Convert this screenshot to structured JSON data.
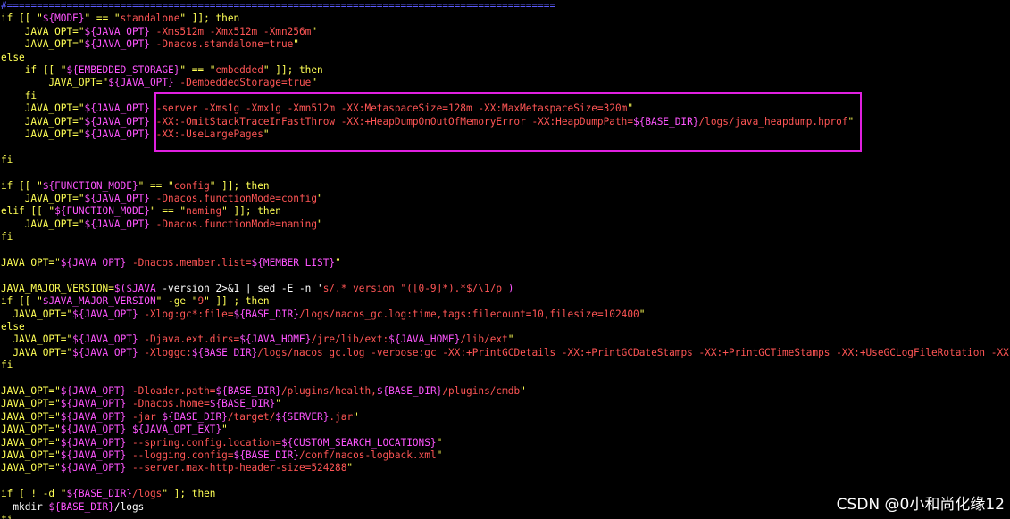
{
  "colors": {
    "plain": "#ffffff",
    "keyword": "#ffff55",
    "variable": "#ff55ff",
    "string": "#ff5555",
    "comment": "#5c5cff",
    "highlight_box": "#e020e0",
    "background": "#000000"
  },
  "watermark": "CSDN @0小和尚化缘12",
  "lines": [
    [
      [
        "#============================================================================================",
        "comment"
      ]
    ],
    [
      [
        "if [[ \"",
        "kw"
      ],
      [
        "${MODE}",
        "var"
      ],
      [
        "\" == \"",
        "kw"
      ],
      [
        "standalone",
        "str"
      ],
      [
        "\" ]]; then",
        "kw"
      ]
    ],
    [
      [
        "    JAVA_OPT=\"",
        "kw"
      ],
      [
        "${JAVA_OPT}",
        "var"
      ],
      [
        " -Xms512m -Xmx512m -Xmn256m",
        "str"
      ],
      [
        "\"",
        "kw"
      ]
    ],
    [
      [
        "    JAVA_OPT=\"",
        "kw"
      ],
      [
        "${JAVA_OPT}",
        "var"
      ],
      [
        " -Dnacos.standalone=true",
        "str"
      ],
      [
        "\"",
        "kw"
      ]
    ],
    [
      [
        "else",
        "kw"
      ]
    ],
    [
      [
        "    if [[ \"",
        "kw"
      ],
      [
        "${EMBEDDED_STORAGE}",
        "var"
      ],
      [
        "\" == \"",
        "kw"
      ],
      [
        "embedded",
        "str"
      ],
      [
        "\" ]]; then",
        "kw"
      ]
    ],
    [
      [
        "        JAVA_OPT=\"",
        "kw"
      ],
      [
        "${JAVA_OPT}",
        "var"
      ],
      [
        " -DembeddedStorage=true",
        "str"
      ],
      [
        "\"",
        "kw"
      ]
    ],
    [
      [
        "    fi",
        "kw"
      ]
    ],
    [
      [
        "    JAVA_OPT=\"",
        "kw"
      ],
      [
        "${JAVA_OPT}",
        "var"
      ],
      [
        " -server -Xms1g -Xmx1g -Xmn512m -XX:MetaspaceSize=128m -XX:MaxMetaspaceSize=320m",
        "str"
      ],
      [
        "\"",
        "kw"
      ]
    ],
    [
      [
        "    JAVA_OPT=\"",
        "kw"
      ],
      [
        "${JAVA_OPT}",
        "var"
      ],
      [
        " -XX:-OmitStackTraceInFastThrow -XX:+HeapDumpOnOutOfMemoryError -XX:HeapDumpPath=",
        "str"
      ],
      [
        "${BASE_DIR}",
        "var"
      ],
      [
        "/logs/java_heapdump.hprof",
        "str"
      ],
      [
        "\"",
        "kw"
      ]
    ],
    [
      [
        "    JAVA_OPT=\"",
        "kw"
      ],
      [
        "${JAVA_OPT}",
        "var"
      ],
      [
        " -XX:-UseLargePages",
        "str"
      ],
      [
        "\"",
        "kw"
      ]
    ],
    [],
    [
      [
        "fi",
        "kw"
      ]
    ],
    [],
    [
      [
        "if [[ \"",
        "kw"
      ],
      [
        "${FUNCTION_MODE}",
        "var"
      ],
      [
        "\" == \"",
        "kw"
      ],
      [
        "config",
        "str"
      ],
      [
        "\" ]]; then",
        "kw"
      ]
    ],
    [
      [
        "    JAVA_OPT=\"",
        "kw"
      ],
      [
        "${JAVA_OPT}",
        "var"
      ],
      [
        " -Dnacos.functionMode=config",
        "str"
      ],
      [
        "\"",
        "kw"
      ]
    ],
    [
      [
        "elif [[ \"",
        "kw"
      ],
      [
        "${FUNCTION_MODE}",
        "var"
      ],
      [
        "\" == \"",
        "kw"
      ],
      [
        "naming",
        "str"
      ],
      [
        "\" ]]; then",
        "kw"
      ]
    ],
    [
      [
        "    JAVA_OPT=\"",
        "kw"
      ],
      [
        "${JAVA_OPT}",
        "var"
      ],
      [
        " -Dnacos.functionMode=naming",
        "str"
      ],
      [
        "\"",
        "kw"
      ]
    ],
    [
      [
        "fi",
        "kw"
      ]
    ],
    [],
    [
      [
        "JAVA_OPT=\"",
        "kw"
      ],
      [
        "${JAVA_OPT}",
        "var"
      ],
      [
        " -Dnacos.member.list=",
        "str"
      ],
      [
        "${MEMBER_LIST}",
        "var"
      ],
      [
        "\"",
        "kw"
      ]
    ],
    [],
    [
      [
        "JAVA_MAJOR_VERSION=",
        "kw"
      ],
      [
        "$(",
        "var"
      ],
      [
        "$JAVA",
        "var"
      ],
      [
        " -version 2>&1 | sed -E -n '",
        "plain"
      ],
      [
        "s/.* version \"([0-9]*).*$/\\1/p",
        "str"
      ],
      [
        "')",
        "var"
      ]
    ],
    [
      [
        "if [[ \"",
        "kw"
      ],
      [
        "$JAVA_MAJOR_VERSION",
        "var"
      ],
      [
        "\" -ge \"",
        "kw"
      ],
      [
        "9",
        "str"
      ],
      [
        "\" ]] ; then",
        "kw"
      ]
    ],
    [
      [
        "  JAVA_OPT=\"",
        "kw"
      ],
      [
        "${JAVA_OPT}",
        "var"
      ],
      [
        " -Xlog:gc*:file=",
        "str"
      ],
      [
        "${BASE_DIR}",
        "var"
      ],
      [
        "/logs/nacos_gc.log:time,tags:filecount=10,filesize=102400",
        "str"
      ],
      [
        "\"",
        "kw"
      ]
    ],
    [
      [
        "else",
        "kw"
      ]
    ],
    [
      [
        "  JAVA_OPT=\"",
        "kw"
      ],
      [
        "${JAVA_OPT}",
        "var"
      ],
      [
        " -Djava.ext.dirs=",
        "str"
      ],
      [
        "${JAVA_HOME}",
        "var"
      ],
      [
        "/jre/lib/ext:",
        "str"
      ],
      [
        "${JAVA_HOME}",
        "var"
      ],
      [
        "/lib/ext",
        "str"
      ],
      [
        "\"",
        "kw"
      ]
    ],
    [
      [
        "  JAVA_OPT=\"",
        "kw"
      ],
      [
        "${JAVA_OPT}",
        "var"
      ],
      [
        " -Xloggc:",
        "str"
      ],
      [
        "${BASE_DIR}",
        "var"
      ],
      [
        "/logs/nacos_gc.log -verbose:gc -XX:+PrintGCDetails -XX:+PrintGCDateStamps -XX:+PrintGCTimeStamps -XX:+UseGCLogFileRotation -XX",
        "str"
      ]
    ],
    [
      [
        "fi",
        "kw"
      ]
    ],
    [],
    [
      [
        "JAVA_OPT=\"",
        "kw"
      ],
      [
        "${JAVA_OPT}",
        "var"
      ],
      [
        " -Dloader.path=",
        "str"
      ],
      [
        "${BASE_DIR}",
        "var"
      ],
      [
        "/plugins/health,",
        "str"
      ],
      [
        "${BASE_DIR}",
        "var"
      ],
      [
        "/plugins/cmdb",
        "str"
      ],
      [
        "\"",
        "kw"
      ]
    ],
    [
      [
        "JAVA_OPT=\"",
        "kw"
      ],
      [
        "${JAVA_OPT}",
        "var"
      ],
      [
        " -Dnacos.home=",
        "str"
      ],
      [
        "${BASE_DIR}",
        "var"
      ],
      [
        "\"",
        "kw"
      ]
    ],
    [
      [
        "JAVA_OPT=\"",
        "kw"
      ],
      [
        "${JAVA_OPT}",
        "var"
      ],
      [
        " -jar ",
        "str"
      ],
      [
        "${BASE_DIR}",
        "var"
      ],
      [
        "/target/",
        "str"
      ],
      [
        "${SERVER}",
        "var"
      ],
      [
        ".jar",
        "str"
      ],
      [
        "\"",
        "kw"
      ]
    ],
    [
      [
        "JAVA_OPT=\"",
        "kw"
      ],
      [
        "${JAVA_OPT}",
        "var"
      ],
      [
        " ",
        "str"
      ],
      [
        "${JAVA_OPT_EXT}",
        "var"
      ],
      [
        "\"",
        "kw"
      ]
    ],
    [
      [
        "JAVA_OPT=\"",
        "kw"
      ],
      [
        "${JAVA_OPT}",
        "var"
      ],
      [
        " --spring.config.location=",
        "str"
      ],
      [
        "${CUSTOM_SEARCH_LOCATIONS}",
        "var"
      ],
      [
        "\"",
        "kw"
      ]
    ],
    [
      [
        "JAVA_OPT=\"",
        "kw"
      ],
      [
        "${JAVA_OPT}",
        "var"
      ],
      [
        " --logging.config=",
        "str"
      ],
      [
        "${BASE_DIR}",
        "var"
      ],
      [
        "/conf/nacos-logback.xml",
        "str"
      ],
      [
        "\"",
        "kw"
      ]
    ],
    [
      [
        "JAVA_OPT=\"",
        "kw"
      ],
      [
        "${JAVA_OPT}",
        "var"
      ],
      [
        " --server.max-http-header-size=524288",
        "str"
      ],
      [
        "\"",
        "kw"
      ]
    ],
    [],
    [
      [
        "if [ ! -d \"",
        "kw"
      ],
      [
        "${BASE_DIR}",
        "var"
      ],
      [
        "/logs",
        "str"
      ],
      [
        "\" ]; then",
        "kw"
      ]
    ],
    [
      [
        "  mkdir ",
        "plain"
      ],
      [
        "${BASE_DIR}",
        "var"
      ],
      [
        "/logs",
        "plain"
      ]
    ],
    [
      [
        "fi",
        "kw"
      ]
    ]
  ]
}
